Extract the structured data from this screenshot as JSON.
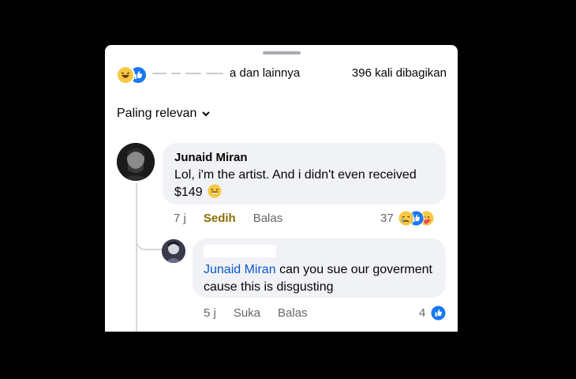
{
  "header": {
    "reactors_suffix": "a dan lainnya",
    "shares": "396 kali dibagikan",
    "reaction_icons": [
      "haha-icon",
      "like-icon"
    ]
  },
  "sort": {
    "label": "Paling relevan"
  },
  "comments": [
    {
      "author": "Junaid Miran",
      "text": "Lol, i'm the artist. And i didn't even received $149",
      "emoji": "grinning-face-icon",
      "time": "7 j",
      "reaction_label": "Sedih",
      "reply_label": "Balas",
      "reaction_count": "37",
      "reaction_icons": [
        "sad-icon",
        "like-icon",
        "care-icon"
      ]
    },
    {
      "author": "",
      "mention": "Junaid Miran",
      "text": "can you sue our goverment cause this is disgusting",
      "time": "5 j",
      "reaction_label": "Suka",
      "reply_label": "Balas",
      "reaction_count": "4",
      "reaction_icons": [
        "like-icon"
      ]
    }
  ],
  "colors": {
    "like": "#1877f2",
    "haha": "#f7c843",
    "mention": "#0a58ca",
    "sad_reaction": "#8a6d00"
  }
}
